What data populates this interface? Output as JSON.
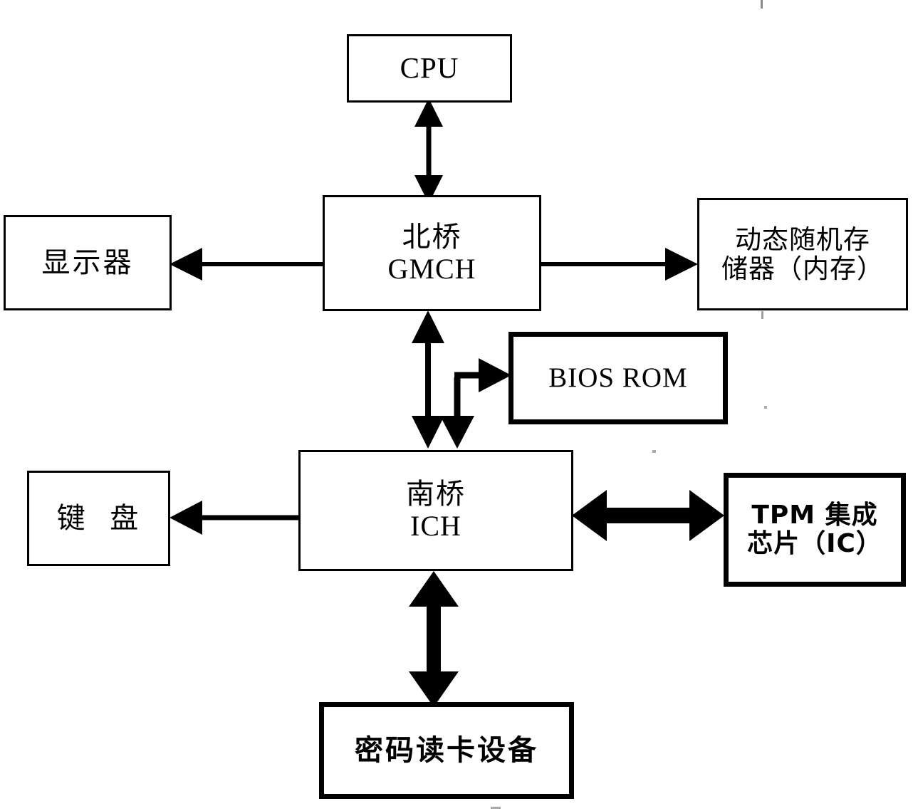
{
  "diagram": {
    "type": "block-diagram",
    "title": "",
    "nodes": [
      {
        "id": "cpu",
        "name": "cpu-box",
        "lines": [
          "CPU"
        ],
        "border": "normal"
      },
      {
        "id": "north_bridge",
        "name": "north-bridge-box",
        "lines": [
          "北桥",
          "GMCH"
        ],
        "border": "normal"
      },
      {
        "id": "display",
        "name": "display-box",
        "lines": [
          "显示器"
        ],
        "border": "normal"
      },
      {
        "id": "dram",
        "name": "dram-box",
        "lines": [
          "动态随机存",
          "储器（内存）"
        ],
        "border": "normal"
      },
      {
        "id": "bios_rom",
        "name": "bios-rom-box",
        "lines": [
          "BIOS ROM"
        ],
        "border": "thick"
      },
      {
        "id": "south_bridge",
        "name": "south-bridge-box",
        "lines": [
          "南桥",
          "ICH"
        ],
        "border": "normal"
      },
      {
        "id": "keyboard",
        "name": "keyboard-box",
        "lines": [
          "键  盘"
        ],
        "border": "normal"
      },
      {
        "id": "tpm",
        "name": "tpm-box",
        "lines": [
          "TPM 集成",
          "芯片（IC）"
        ],
        "border": "thick"
      },
      {
        "id": "card_reader",
        "name": "card-reader-box",
        "lines": [
          "密码读卡设备"
        ],
        "border": "thick"
      }
    ],
    "edges": [
      {
        "id": "cpu_nb",
        "name": "edge-cpu-northbridge",
        "from": "cpu",
        "to": "north_bridge",
        "direction": "bidirectional",
        "weight": "thin",
        "orientation": "vertical"
      },
      {
        "id": "nb_display",
        "name": "edge-northbridge-display",
        "from": "north_bridge",
        "to": "display",
        "direction": "single",
        "weight": "thin",
        "orientation": "horizontal"
      },
      {
        "id": "nb_dram",
        "name": "edge-northbridge-dram",
        "from": "north_bridge",
        "to": "dram",
        "direction": "single",
        "weight": "thin",
        "orientation": "horizontal"
      },
      {
        "id": "nb_sb",
        "name": "edge-northbridge-southbridge",
        "from": "north_bridge",
        "to": "south_bridge",
        "direction": "bidirectional",
        "weight": "thin",
        "orientation": "vertical"
      },
      {
        "id": "sb_bios",
        "name": "edge-southbridge-bios",
        "from": "south_bridge",
        "to": "bios_rom",
        "direction": "bidirectional",
        "weight": "thin",
        "orientation": "elbow"
      },
      {
        "id": "sb_keyboard",
        "name": "edge-southbridge-keyboard",
        "from": "south_bridge",
        "to": "keyboard",
        "direction": "single",
        "weight": "thin",
        "orientation": "horizontal"
      },
      {
        "id": "sb_tpm",
        "name": "edge-southbridge-tpm",
        "from": "south_bridge",
        "to": "tpm",
        "direction": "bidirectional",
        "weight": "thick",
        "orientation": "horizontal"
      },
      {
        "id": "sb_reader",
        "name": "edge-southbridge-cardreader",
        "from": "south_bridge",
        "to": "card_reader",
        "direction": "bidirectional",
        "weight": "thick",
        "orientation": "vertical"
      }
    ],
    "colors": {
      "stroke": "#000000",
      "background": "#ffffff",
      "text": "#000000"
    }
  }
}
